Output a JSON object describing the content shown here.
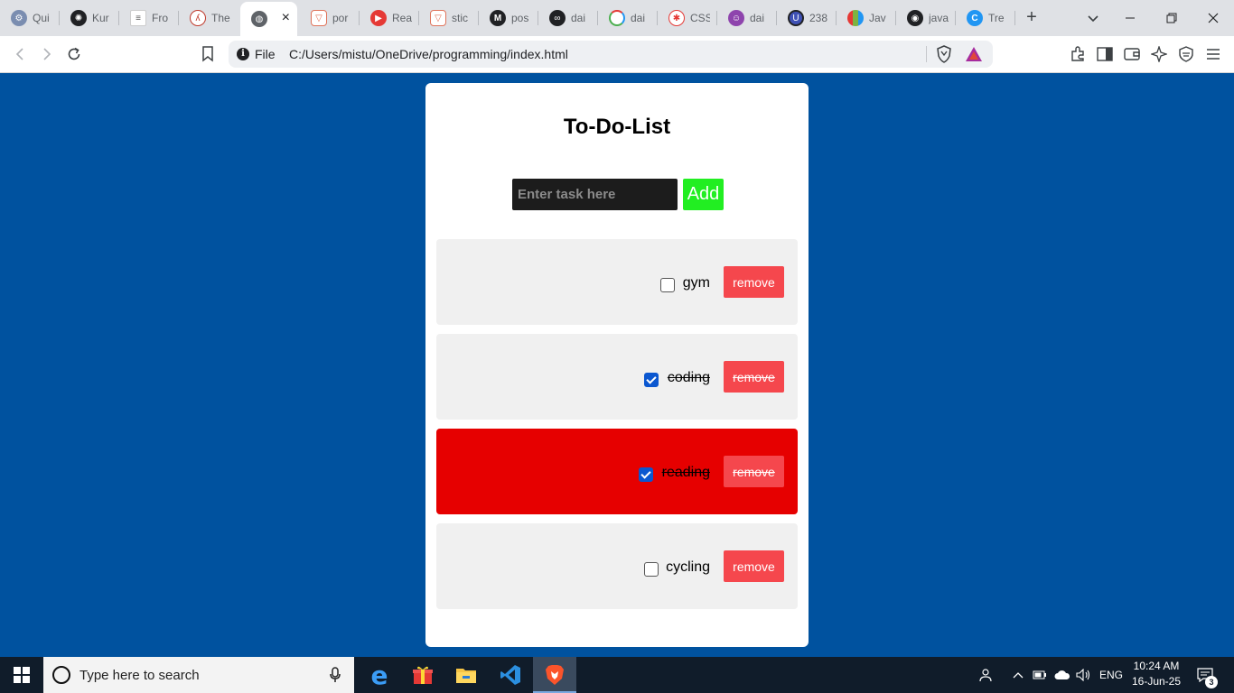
{
  "browser": {
    "tabs": [
      {
        "title": "Qui",
        "icon": "gear-icon",
        "color": "#7a8db0"
      },
      {
        "title": "Kur",
        "icon": "openai-icon",
        "color": "#202124"
      },
      {
        "title": "Fro",
        "icon": "document-icon",
        "color": "#9aa0a6"
      },
      {
        "title": "The",
        "icon": "figure-icon",
        "color": "#c0392b"
      },
      {
        "title": "",
        "icon": "globe-icon",
        "color": "#5f6368",
        "active": true
      },
      {
        "title": "por",
        "icon": "brave-shield-icon",
        "color": "#e0735a"
      },
      {
        "title": "Rea",
        "icon": "youtube-icon",
        "color": "#e53935"
      },
      {
        "title": "stic",
        "icon": "brave-shield-icon",
        "color": "#e0735a"
      },
      {
        "title": "pos",
        "icon": "medium-icon",
        "color": "#202124"
      },
      {
        "title": "dai",
        "icon": "daily-dev-icon",
        "color": "#202124"
      },
      {
        "title": "dai",
        "icon": "rainbow-icon",
        "color": "#4caf50"
      },
      {
        "title": "CSS",
        "icon": "asterisk-icon",
        "color": "#e53935"
      },
      {
        "title": "dai",
        "icon": "purple-logo-icon",
        "color": "#8e44ad"
      },
      {
        "title": "238",
        "icon": "app-logo-icon",
        "color": "#3f51b5"
      },
      {
        "title": "Jav",
        "icon": "book-icon",
        "color": "#7cb342"
      },
      {
        "title": "java",
        "icon": "github-icon",
        "color": "#202124"
      },
      {
        "title": "Tre",
        "icon": "c-logo-icon",
        "color": "#2196f3"
      }
    ],
    "close_tab": "×",
    "new_tab": "+",
    "address": {
      "scheme_label": "File",
      "url": "C:/Users/mistu/OneDrive/programming/index.html"
    }
  },
  "page": {
    "title": "To-Do-List",
    "input_placeholder": "Enter task here",
    "input_value": "",
    "add_label": "Add",
    "tasks": [
      {
        "text": "gym",
        "done": false,
        "highlighted": false,
        "remove_label": "remove"
      },
      {
        "text": "coding",
        "done": true,
        "highlighted": false,
        "remove_label": "remove"
      },
      {
        "text": "reading",
        "done": true,
        "highlighted": true,
        "remove_label": "remove"
      },
      {
        "text": "cycling",
        "done": false,
        "highlighted": false,
        "remove_label": "remove"
      }
    ]
  },
  "taskbar": {
    "search_placeholder": "Type here to search",
    "language": "ENG",
    "time": "10:24 AM",
    "date": "16-Jun-25",
    "notification_count": "3"
  },
  "colors": {
    "page_background": "#00529f",
    "add_button": "#22ee22",
    "remove_button": "#f5474d",
    "highlight_item": "#e60000",
    "item_background": "#f0f0f0"
  }
}
